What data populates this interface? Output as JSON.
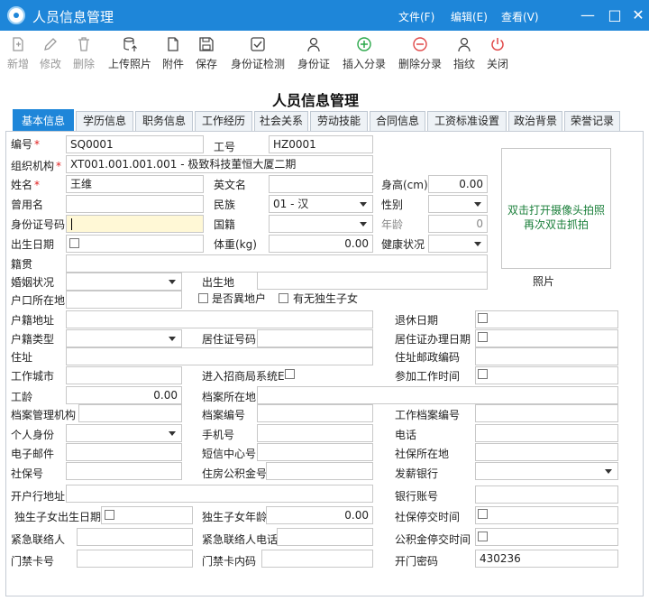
{
  "window": {
    "title": "人员信息管理",
    "menus": [
      "文件(F)",
      "编辑(E)",
      "查看(V)"
    ]
  },
  "toolbar": [
    {
      "label": "新增",
      "icon": "new-document-icon",
      "enabled": false
    },
    {
      "label": "修改",
      "icon": "edit-pencil-icon",
      "enabled": false
    },
    {
      "label": "删除",
      "icon": "trash-icon",
      "enabled": false
    },
    {
      "label": "上传照片",
      "icon": "upload-database-icon",
      "enabled": true
    },
    {
      "label": "附件",
      "icon": "attachment-icon",
      "enabled": true
    },
    {
      "label": "保存",
      "icon": "save-disk-icon",
      "enabled": true
    },
    {
      "label": "身份证检测",
      "icon": "check-box-icon",
      "enabled": true
    },
    {
      "label": "身份证",
      "icon": "id-person-icon",
      "enabled": true
    },
    {
      "label": "插入分录",
      "icon": "plus-circle-icon",
      "enabled": true,
      "color": "#2aa84a"
    },
    {
      "label": "删除分录",
      "icon": "minus-circle-icon",
      "enabled": true,
      "color": "#e04848"
    },
    {
      "label": "指纹",
      "icon": "fingerprint-person-icon",
      "enabled": true
    },
    {
      "label": "关闭",
      "icon": "power-icon",
      "enabled": true,
      "color": "#e04848"
    }
  ],
  "page_title": "人员信息管理",
  "tabs": [
    "基本信息",
    "学历信息",
    "职务信息",
    "工作经历",
    "社会关系",
    "劳动技能",
    "合同信息",
    "工资标准设置",
    "政治背景",
    "荣誉记录"
  ],
  "active_tab": "基本信息",
  "photo": {
    "line1": "双击打开摄像头拍照",
    "line2": "再次双击抓拍",
    "label": "照片"
  },
  "form": {
    "number_label": "编号",
    "number": "SQ0001",
    "work_id_label": "工号",
    "work_id": "HZ0001",
    "org_label": "组织机构",
    "org": "XT001.001.001.001 - 极致科技董恒大厦二期",
    "name_label": "姓名",
    "name": "王维",
    "english_name_label": "英文名",
    "english_name": "",
    "height_label": "身高(cm)",
    "height": "0.00",
    "former_name_label": "曾用名",
    "ethnicity_label": "民族",
    "ethnicity": "01 - 汉",
    "gender_label": "性别",
    "id_number_label": "身份证号码",
    "nationality_label": "国籍",
    "age_label": "年龄",
    "age": "0",
    "birth_date_label": "出生日期",
    "weight_label": "体重(kg)",
    "weight": "0.00",
    "health_label": "健康状况",
    "origin_label": "籍贯",
    "marital_label": "婚姻状况",
    "birthplace_label": "出生地",
    "hukou_place_label": "户口所在地",
    "local_hukou_label": "是否異地户",
    "only_child_label": "有无独生子女",
    "hukou_address_label": "户籍地址",
    "retire_date_label": "退休日期",
    "hukou_type_label": "户籍类型",
    "residence_permit_label": "居住证号码",
    "residence_permit_date_label": "居住证办理日期",
    "address_label": "住址",
    "address_postcode_label": "住址邮政编码",
    "work_city_label": "工作城市",
    "join_system_label": "进入招商局系统E",
    "join_work_time_label": "参加工作时间",
    "seniority_label": "工龄",
    "seniority": "0.00",
    "archive_location_label": "档案所在地",
    "archive_agency_label": "档案管理机构",
    "archive_number_label": "档案编号",
    "work_archive_number_label": "工作档案编号",
    "identity_label": "个人身份",
    "mobile_label": "手机号",
    "phone_label": "电话",
    "email_label": "电子邮件",
    "sms_center_label": "短信中心号",
    "social_place_label": "社保所在地",
    "social_number_label": "社保号",
    "housing_fund_label": "住房公积金号",
    "pay_bank_label": "发薪银行",
    "bank_address_label": "开户行地址",
    "bank_account_label": "银行账号",
    "child_birth_label": "独生子女出生日期",
    "child_age_label": "独生子女年龄",
    "child_age": "0.00",
    "social_stop_label": "社保停交时间",
    "emergency_contact_label": "紧急联络人",
    "emergency_phone_label": "紧急联络人电话",
    "fund_stop_label": "公积金停交时间",
    "access_card_label": "门禁卡号",
    "access_card_code_label": "门禁卡内码",
    "door_password_label": "开门密码",
    "door_password": "430236"
  },
  "colors": {
    "accent": "#1e86d9",
    "required": "#e02020",
    "photo_text": "#1a7f3a"
  }
}
